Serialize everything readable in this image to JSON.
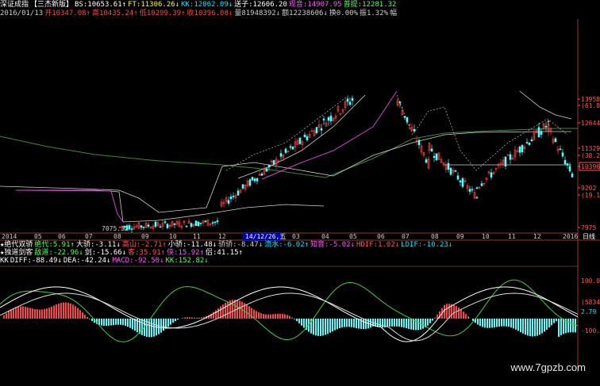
{
  "header": {
    "line1": [
      {
        "text": "深证成指",
        "color": "#ffffff"
      },
      {
        "text": "【三杰新版】",
        "color": "#ffffff"
      },
      {
        "text": "BS:10653.61↑",
        "color": "#ffffff"
      },
      {
        "text": "FT:11306.26↓",
        "color": "#ffff00"
      },
      {
        "text": "KK:12062.09↓",
        "color": "#00e5ff"
      },
      {
        "text": "送子:12606.20",
        "color": "#ffffff"
      },
      {
        "text": "观音:14907.95",
        "color": "#ff55ff"
      },
      {
        "text": "普提:12281.32",
        "color": "#55ff55"
      }
    ],
    "line2": [
      {
        "text": "2016/01/13",
        "color": "#cccccc"
      },
      {
        "text": "开10347.08↑",
        "color": "#ff4444"
      },
      {
        "text": "高10435.24↑",
        "color": "#ff4444"
      },
      {
        "text": "低10299.39↑",
        "color": "#ff4444"
      },
      {
        "text": "收10396.08↓",
        "color": "#ff4444"
      },
      {
        "text": "量81948392↓",
        "color": "#cccccc"
      },
      {
        "text": "额12238606↓",
        "color": "#cccccc"
      },
      {
        "text": "换0.00%",
        "color": "#cccccc"
      },
      {
        "text": "振1.32%",
        "color": "#cccccc"
      },
      {
        "text": "幅",
        "color": "#cccccc"
      }
    ]
  },
  "price_axis": [
    {
      "label": "13958",
      "color": "#ff5555"
    },
    {
      "label": "(61.8%)",
      "color": "#ff5555"
    },
    {
      "label": "12644",
      "color": "#ff5555"
    },
    {
      "label": "11329",
      "color": "#ff5555"
    },
    {
      "label": "(38.2%)",
      "color": "#ff5555"
    },
    {
      "label": "10396",
      "color": "#ff5555"
    },
    {
      "label": "9202",
      "color": "#ff5555"
    },
    {
      "label": "(19.1%)",
      "color": "#ff5555"
    },
    {
      "label": "7975",
      "color": "#ff5555"
    }
  ],
  "low_marker": "7075.32",
  "timeline": {
    "labels": [
      "2014",
      "05",
      "06",
      "07",
      "08",
      "09",
      "10",
      "11",
      "12",
      "14/12/26,五",
      "03",
      "04",
      "05",
      "06",
      "07",
      "08",
      "09",
      "10",
      "11",
      "12",
      "2016"
    ],
    "period": "日线"
  },
  "indicator_lines": [
    [
      {
        "text": "★绝代双骄",
        "color": "#ffffff"
      },
      {
        "text": "绝代:5.91↑",
        "color": "#55ff55"
      },
      {
        "text": "大骄:-3.11↓",
        "color": "#ffffff"
      },
      {
        "text": "高山:-2.71↑",
        "color": "#ff5555"
      },
      {
        "text": "小骄:-11.48↓",
        "color": "#ffffff"
      },
      {
        "text": "骄骄:-8.47↓",
        "color": "#cccccc"
      },
      {
        "text": "流水:-6.02↑",
        "color": "#00e5ff"
      },
      {
        "text": "知音:-5.02↓",
        "color": "#ff55ff"
      },
      {
        "text": "HDIF:1.02↓",
        "color": "#ff5555"
      },
      {
        "text": "LDIF:-10.23↓",
        "color": "#00e5ff"
      }
    ],
    [
      {
        "text": "★独道剑客",
        "color": "#ffffff"
      },
      {
        "text": "敌道:-22.96↓",
        "color": "#55ff55"
      },
      {
        "text": "剑:-15.66↓",
        "color": "#ffffff"
      },
      {
        "text": "客:35.91↑",
        "color": "#ff5555"
      },
      {
        "text": "侠:15.92↑",
        "color": "#ff55ff"
      },
      {
        "text": "侣:41.15↑",
        "color": "#ffffff"
      }
    ],
    [
      {
        "text": "KK",
        "color": "#ffffff"
      },
      {
        "text": "DIFF:-88.49↓",
        "color": "#ffffff"
      },
      {
        "text": "DEA:-42.24↓",
        "color": "#ffffff"
      },
      {
        "text": "MACD:-92.50↓",
        "color": "#ff55ff"
      },
      {
        "text": "KK:152.82↓",
        "color": "#55ff55"
      }
    ]
  ],
  "indicator_axis": [
    {
      "label": "100.00",
      "color": "#ff5555"
    },
    {
      "label": "(5834)",
      "color": "#ff5555"
    },
    {
      "label": "2.79",
      "color": "#00e5ff"
    },
    {
      "label": "-100.00",
      "color": "#ff5555"
    }
  ],
  "watermark": "www.7gpzb.com",
  "colors": {
    "background": "#000000",
    "up_candle": "#ff4444",
    "down_candle": "#55ffff",
    "grid": "#993333"
  }
}
